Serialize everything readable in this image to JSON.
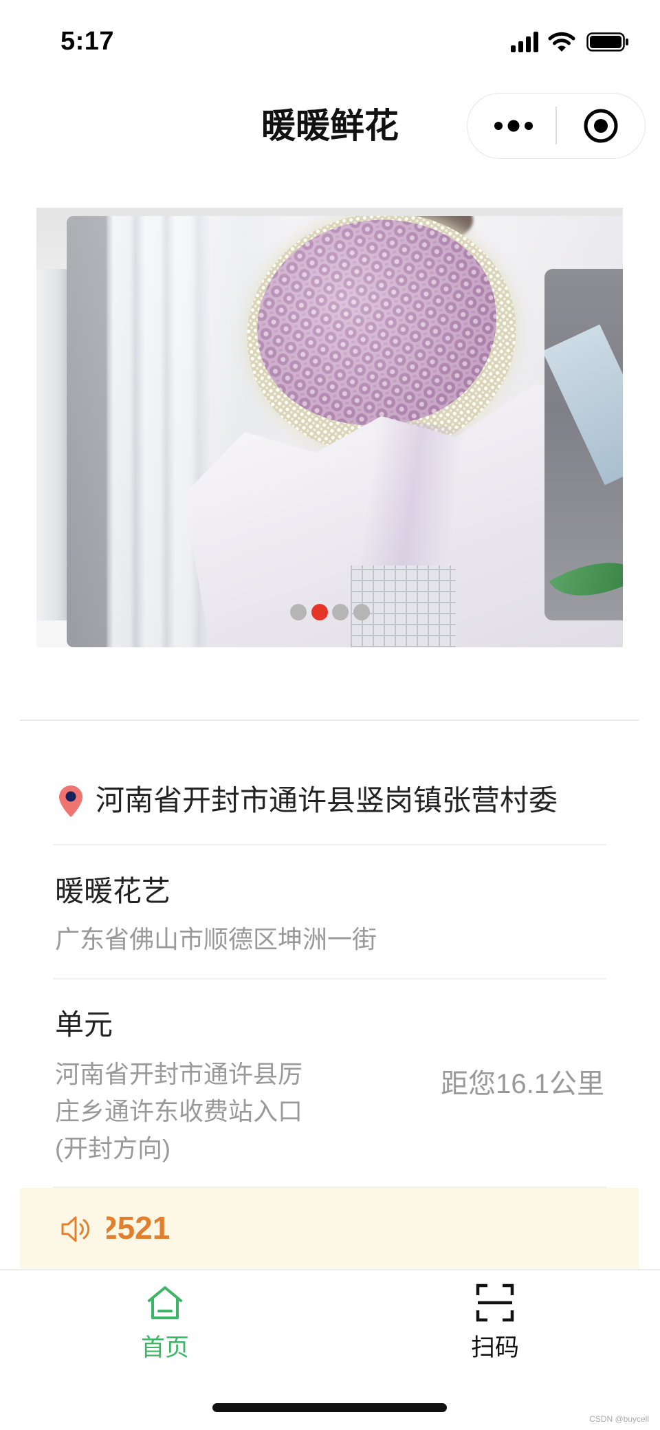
{
  "status_bar": {
    "time": "5:17"
  },
  "nav": {
    "title": "暖暖鲜花"
  },
  "carousel": {
    "slides": 4,
    "active_index": 1
  },
  "location": {
    "text": "河南省开封市通许县竖岗镇张营村委"
  },
  "stores": [
    {
      "name": "暖暖花艺",
      "address": "广东省佛山市顺德区坤洲一街"
    },
    {
      "name": "单元",
      "address_lines": [
        "河南省开封市通许县厉",
        "庄乡通许东收费站入口",
        "(开封方向)"
      ],
      "distance": "距您16.1公里"
    }
  ],
  "notice": {
    "text": "2521"
  },
  "tabbar": {
    "items": [
      {
        "label": "首页",
        "active": true
      },
      {
        "label": "扫码",
        "active": false
      }
    ]
  },
  "watermark": "CSDN @buycell",
  "icons": {
    "status": [
      "cellular-signal-icon",
      "wifi-icon",
      "battery-icon"
    ],
    "capsule": [
      "more-dots-icon",
      "target-icon"
    ],
    "location": "map-pin-icon",
    "notice": "speaker-icon",
    "tabs": [
      "home-icon",
      "scan-icon"
    ]
  },
  "colors": {
    "accent_green": "#3cb664",
    "notice_orange": "#e27f2e",
    "indicator_active": "#e53528",
    "indicator_inactive": "#b5b5b5",
    "notice_background": "#fdf8e5",
    "pin": "#f07470"
  }
}
